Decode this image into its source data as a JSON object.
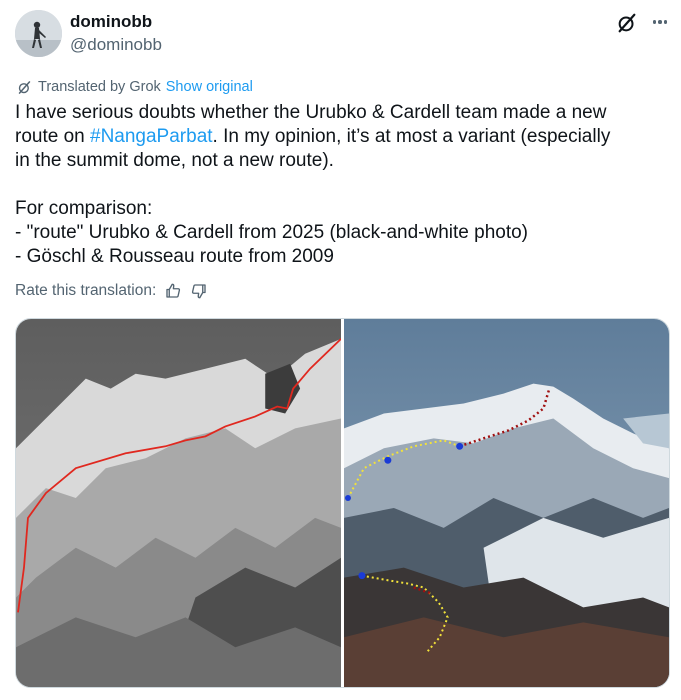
{
  "author": {
    "display_name": "dominobb",
    "handle": "@dominobb",
    "avatar_icon": "person-silhouette-avatar"
  },
  "header_icons": {
    "grok": "grok-icon",
    "more": "more-dots-icon"
  },
  "translation": {
    "label": "Translated by Grok",
    "show_original": "Show original",
    "icon": "grok-icon"
  },
  "tweet": {
    "line1": "I have serious doubts whether the Urubko & Cardell team made a new",
    "line2_before": "route on ",
    "hashtag": "#NangaParbat",
    "line2_after": ". In my opinion, it’s at most a variant (especially",
    "line3": "in the summit dome, not a new route).",
    "line5": "For comparison:",
    "line6": "- \"route\" Urubko & Cardell from 2025 (black-and-white photo)",
    "line7": "- Göschl & Rousseau route from 2009"
  },
  "rate": {
    "label": "Rate this translation:",
    "thumbs_up_icon": "thumbs-up-icon",
    "thumbs_down_icon": "thumbs-down-icon"
  },
  "media": {
    "photos": [
      {
        "description_icon": "mountain-photo-bw",
        "route_color": "#e0281f"
      },
      {
        "description_icon": "mountain-photo-color",
        "route_color": "#f2e23a"
      }
    ]
  },
  "colors": {
    "accent": "#1d9bf0",
    "secondary_text": "#536471"
  }
}
